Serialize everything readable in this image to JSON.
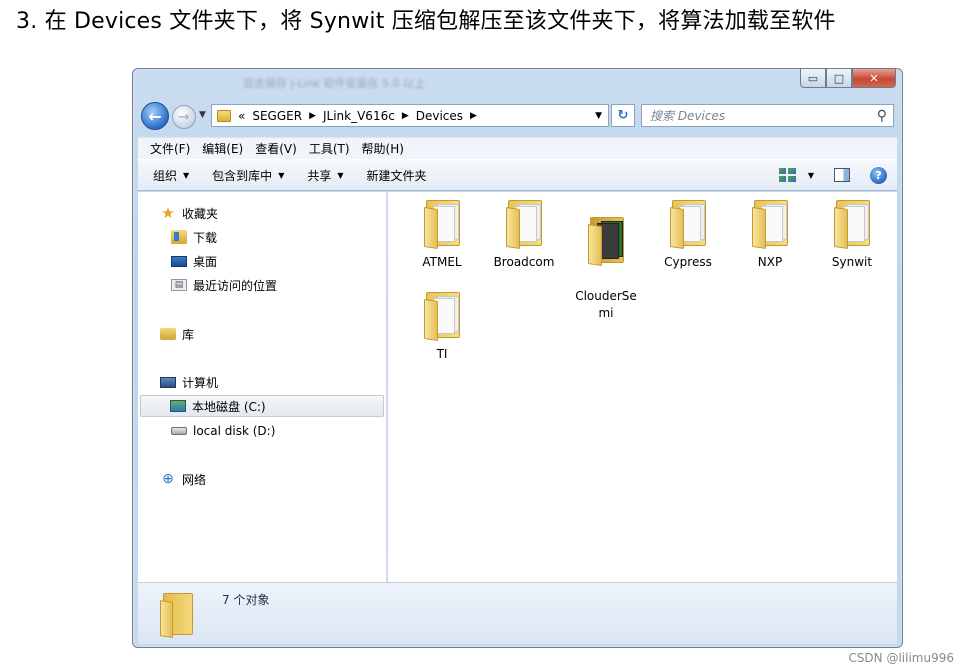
{
  "heading": "3.  在 Devices 文件夹下，将 Synwit 压缩包解压至该文件夹下，将算法加载至软件",
  "window": {
    "title_blurred": "双击保存 j-Link 软件安装在 5.0 以上",
    "buttons": {
      "minimize": "▭",
      "maximize": "□",
      "close": "✕"
    }
  },
  "address": {
    "overflow": "«",
    "crumbs": [
      "SEGGER",
      "JLink_V616c",
      "Devices"
    ],
    "search_placeholder": "搜索 Devices"
  },
  "menu": [
    "文件(F)",
    "编辑(E)",
    "查看(V)",
    "工具(T)",
    "帮助(H)"
  ],
  "toolbar": {
    "organize": "组织",
    "include_library": "包含到库中",
    "share": "共享",
    "new_folder": "新建文件夹"
  },
  "nav": {
    "favorites": "收藏夹",
    "downloads": "下载",
    "desktop": "桌面",
    "recent": "最近访问的位置",
    "libraries": "库",
    "computer": "计算机",
    "local_c": "本地磁盘 (C:)",
    "local_d": "local disk (D:)",
    "network": "网络"
  },
  "files": [
    "ATMEL",
    "Broadcom",
    "ClouderSe\nmi",
    "Cypress",
    "NXP",
    "Synwit",
    "TI"
  ],
  "status": {
    "count": "7 个对象"
  },
  "watermark": "CSDN @lilimu996",
  "icons": {
    "back": "back-arrow-icon",
    "forward": "forward-arrow-icon",
    "refresh": "refresh-icon",
    "search": "search-icon",
    "help": "help-icon"
  }
}
